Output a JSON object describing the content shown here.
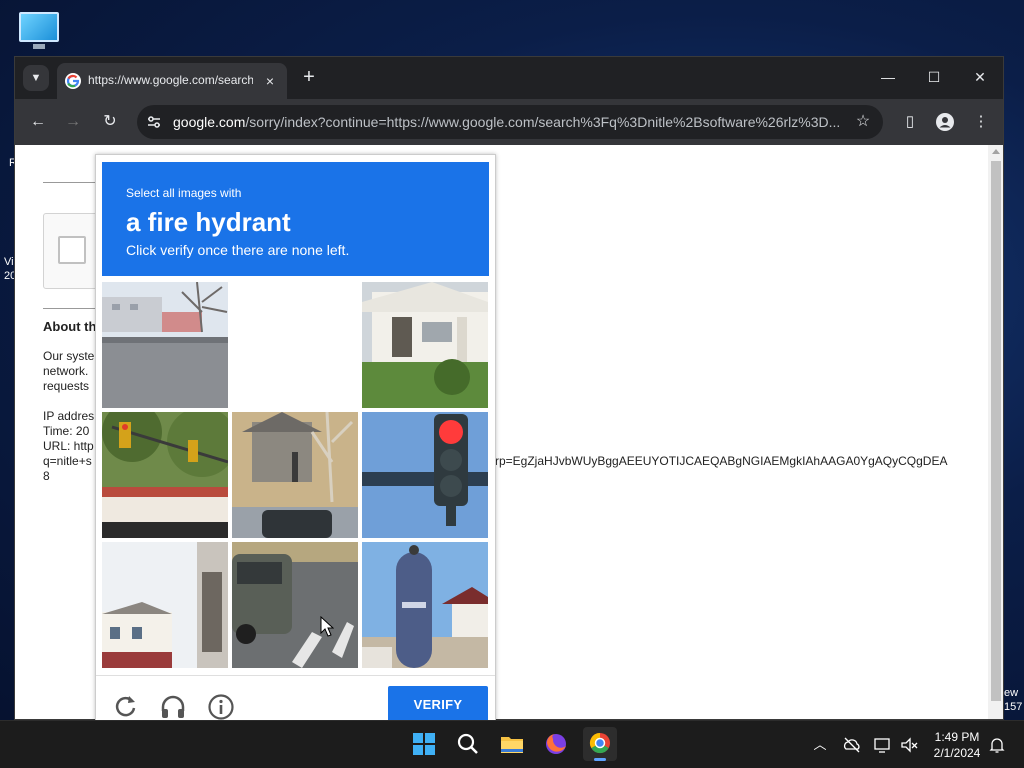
{
  "desktop": {
    "fragments": [
      "R",
      "Vi",
      "20",
      "ew",
      "157"
    ]
  },
  "browser": {
    "tab": {
      "title": "https://www.google.com/search",
      "close": "×"
    },
    "new_tab": "+",
    "window_controls": {
      "minimize": "—",
      "maximize": "☐",
      "close": "✕"
    },
    "url_host": "google.com",
    "url_rest": "/sorry/index?continue=https://www.google.com/search%3Fq%3Dnitle%2Bsoftware%26rlz%3D..."
  },
  "page": {
    "about_heading": "About th",
    "para_lines": [
      "Our syste",
      "network.",
      "requests"
    ],
    "ip_label": "IP addres",
    "time_label": "Time: 20",
    "url_label": "URL: http",
    "q_label": "q=nitle+s",
    "eight": "8",
    "long_param": "rp=EgZjaHJvbWUyBggAEEUYOTIJCAEQABgNGIAEMgkIAhAAGA0YgAQyCQgDEA"
  },
  "captcha": {
    "instruction_small": "Select all images with",
    "target": "a fire hydrant",
    "instruction_sub": "Click verify once there are none left.",
    "verify_label": "VERIFY"
  },
  "taskbar": {
    "time": "1:49 PM",
    "date": "2/1/2024"
  },
  "colors": {
    "captcha_blue": "#1a73e8",
    "chrome_dark": "#202124",
    "chrome_toolbar": "#35363a"
  }
}
